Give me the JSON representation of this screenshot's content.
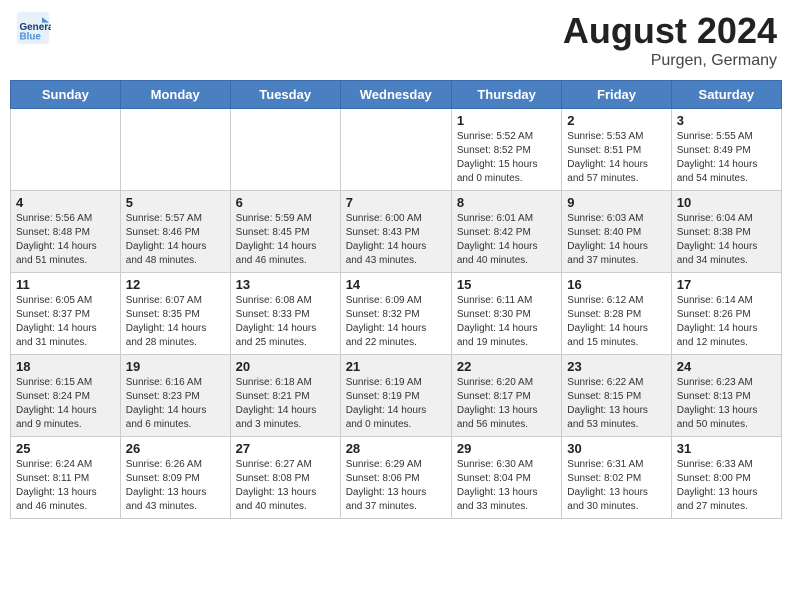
{
  "header": {
    "logo_line1": "General",
    "logo_line2": "Blue",
    "month": "August 2024",
    "location": "Purgen, Germany"
  },
  "weekdays": [
    "Sunday",
    "Monday",
    "Tuesday",
    "Wednesday",
    "Thursday",
    "Friday",
    "Saturday"
  ],
  "weeks": [
    [
      {
        "day": "",
        "info": ""
      },
      {
        "day": "",
        "info": ""
      },
      {
        "day": "",
        "info": ""
      },
      {
        "day": "",
        "info": ""
      },
      {
        "day": "1",
        "info": "Sunrise: 5:52 AM\nSunset: 8:52 PM\nDaylight: 15 hours\nand 0 minutes."
      },
      {
        "day": "2",
        "info": "Sunrise: 5:53 AM\nSunset: 8:51 PM\nDaylight: 14 hours\nand 57 minutes."
      },
      {
        "day": "3",
        "info": "Sunrise: 5:55 AM\nSunset: 8:49 PM\nDaylight: 14 hours\nand 54 minutes."
      }
    ],
    [
      {
        "day": "4",
        "info": "Sunrise: 5:56 AM\nSunset: 8:48 PM\nDaylight: 14 hours\nand 51 minutes."
      },
      {
        "day": "5",
        "info": "Sunrise: 5:57 AM\nSunset: 8:46 PM\nDaylight: 14 hours\nand 48 minutes."
      },
      {
        "day": "6",
        "info": "Sunrise: 5:59 AM\nSunset: 8:45 PM\nDaylight: 14 hours\nand 46 minutes."
      },
      {
        "day": "7",
        "info": "Sunrise: 6:00 AM\nSunset: 8:43 PM\nDaylight: 14 hours\nand 43 minutes."
      },
      {
        "day": "8",
        "info": "Sunrise: 6:01 AM\nSunset: 8:42 PM\nDaylight: 14 hours\nand 40 minutes."
      },
      {
        "day": "9",
        "info": "Sunrise: 6:03 AM\nSunset: 8:40 PM\nDaylight: 14 hours\nand 37 minutes."
      },
      {
        "day": "10",
        "info": "Sunrise: 6:04 AM\nSunset: 8:38 PM\nDaylight: 14 hours\nand 34 minutes."
      }
    ],
    [
      {
        "day": "11",
        "info": "Sunrise: 6:05 AM\nSunset: 8:37 PM\nDaylight: 14 hours\nand 31 minutes."
      },
      {
        "day": "12",
        "info": "Sunrise: 6:07 AM\nSunset: 8:35 PM\nDaylight: 14 hours\nand 28 minutes."
      },
      {
        "day": "13",
        "info": "Sunrise: 6:08 AM\nSunset: 8:33 PM\nDaylight: 14 hours\nand 25 minutes."
      },
      {
        "day": "14",
        "info": "Sunrise: 6:09 AM\nSunset: 8:32 PM\nDaylight: 14 hours\nand 22 minutes."
      },
      {
        "day": "15",
        "info": "Sunrise: 6:11 AM\nSunset: 8:30 PM\nDaylight: 14 hours\nand 19 minutes."
      },
      {
        "day": "16",
        "info": "Sunrise: 6:12 AM\nSunset: 8:28 PM\nDaylight: 14 hours\nand 15 minutes."
      },
      {
        "day": "17",
        "info": "Sunrise: 6:14 AM\nSunset: 8:26 PM\nDaylight: 14 hours\nand 12 minutes."
      }
    ],
    [
      {
        "day": "18",
        "info": "Sunrise: 6:15 AM\nSunset: 8:24 PM\nDaylight: 14 hours\nand 9 minutes."
      },
      {
        "day": "19",
        "info": "Sunrise: 6:16 AM\nSunset: 8:23 PM\nDaylight: 14 hours\nand 6 minutes."
      },
      {
        "day": "20",
        "info": "Sunrise: 6:18 AM\nSunset: 8:21 PM\nDaylight: 14 hours\nand 3 minutes."
      },
      {
        "day": "21",
        "info": "Sunrise: 6:19 AM\nSunset: 8:19 PM\nDaylight: 14 hours\nand 0 minutes."
      },
      {
        "day": "22",
        "info": "Sunrise: 6:20 AM\nSunset: 8:17 PM\nDaylight: 13 hours\nand 56 minutes."
      },
      {
        "day": "23",
        "info": "Sunrise: 6:22 AM\nSunset: 8:15 PM\nDaylight: 13 hours\nand 53 minutes."
      },
      {
        "day": "24",
        "info": "Sunrise: 6:23 AM\nSunset: 8:13 PM\nDaylight: 13 hours\nand 50 minutes."
      }
    ],
    [
      {
        "day": "25",
        "info": "Sunrise: 6:24 AM\nSunset: 8:11 PM\nDaylight: 13 hours\nand 46 minutes."
      },
      {
        "day": "26",
        "info": "Sunrise: 6:26 AM\nSunset: 8:09 PM\nDaylight: 13 hours\nand 43 minutes."
      },
      {
        "day": "27",
        "info": "Sunrise: 6:27 AM\nSunset: 8:08 PM\nDaylight: 13 hours\nand 40 minutes."
      },
      {
        "day": "28",
        "info": "Sunrise: 6:29 AM\nSunset: 8:06 PM\nDaylight: 13 hours\nand 37 minutes."
      },
      {
        "day": "29",
        "info": "Sunrise: 6:30 AM\nSunset: 8:04 PM\nDaylight: 13 hours\nand 33 minutes."
      },
      {
        "day": "30",
        "info": "Sunrise: 6:31 AM\nSunset: 8:02 PM\nDaylight: 13 hours\nand 30 minutes."
      },
      {
        "day": "31",
        "info": "Sunrise: 6:33 AM\nSunset: 8:00 PM\nDaylight: 13 hours\nand 27 minutes."
      }
    ]
  ]
}
